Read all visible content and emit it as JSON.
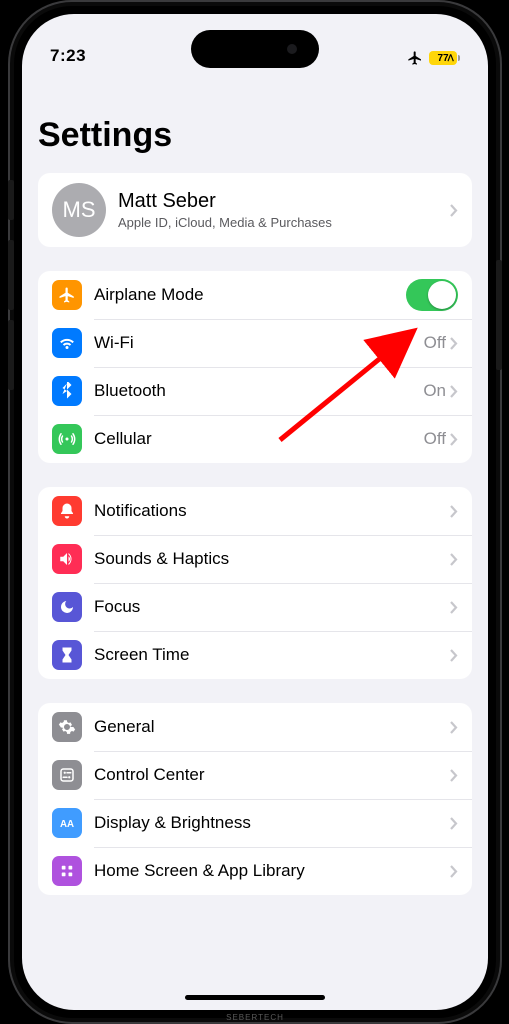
{
  "status": {
    "time": "7:23",
    "battery": "77"
  },
  "title": "Settings",
  "profile": {
    "initials": "MS",
    "name": "Matt Seber",
    "subtitle": "Apple ID, iCloud, Media & Purchases"
  },
  "connectivity": {
    "airplane": {
      "label": "Airplane Mode",
      "on": true
    },
    "wifi": {
      "label": "Wi-Fi",
      "value": "Off"
    },
    "bluetooth": {
      "label": "Bluetooth",
      "value": "On"
    },
    "cellular": {
      "label": "Cellular",
      "value": "Off"
    }
  },
  "alerts": {
    "notifications": "Notifications",
    "sounds": "Sounds & Haptics",
    "focus": "Focus",
    "screentime": "Screen Time"
  },
  "system": {
    "general": "General",
    "controlcenter": "Control Center",
    "display": "Display & Brightness",
    "homescreen": "Home Screen & App Library"
  },
  "watermark": "SEBERTECH"
}
